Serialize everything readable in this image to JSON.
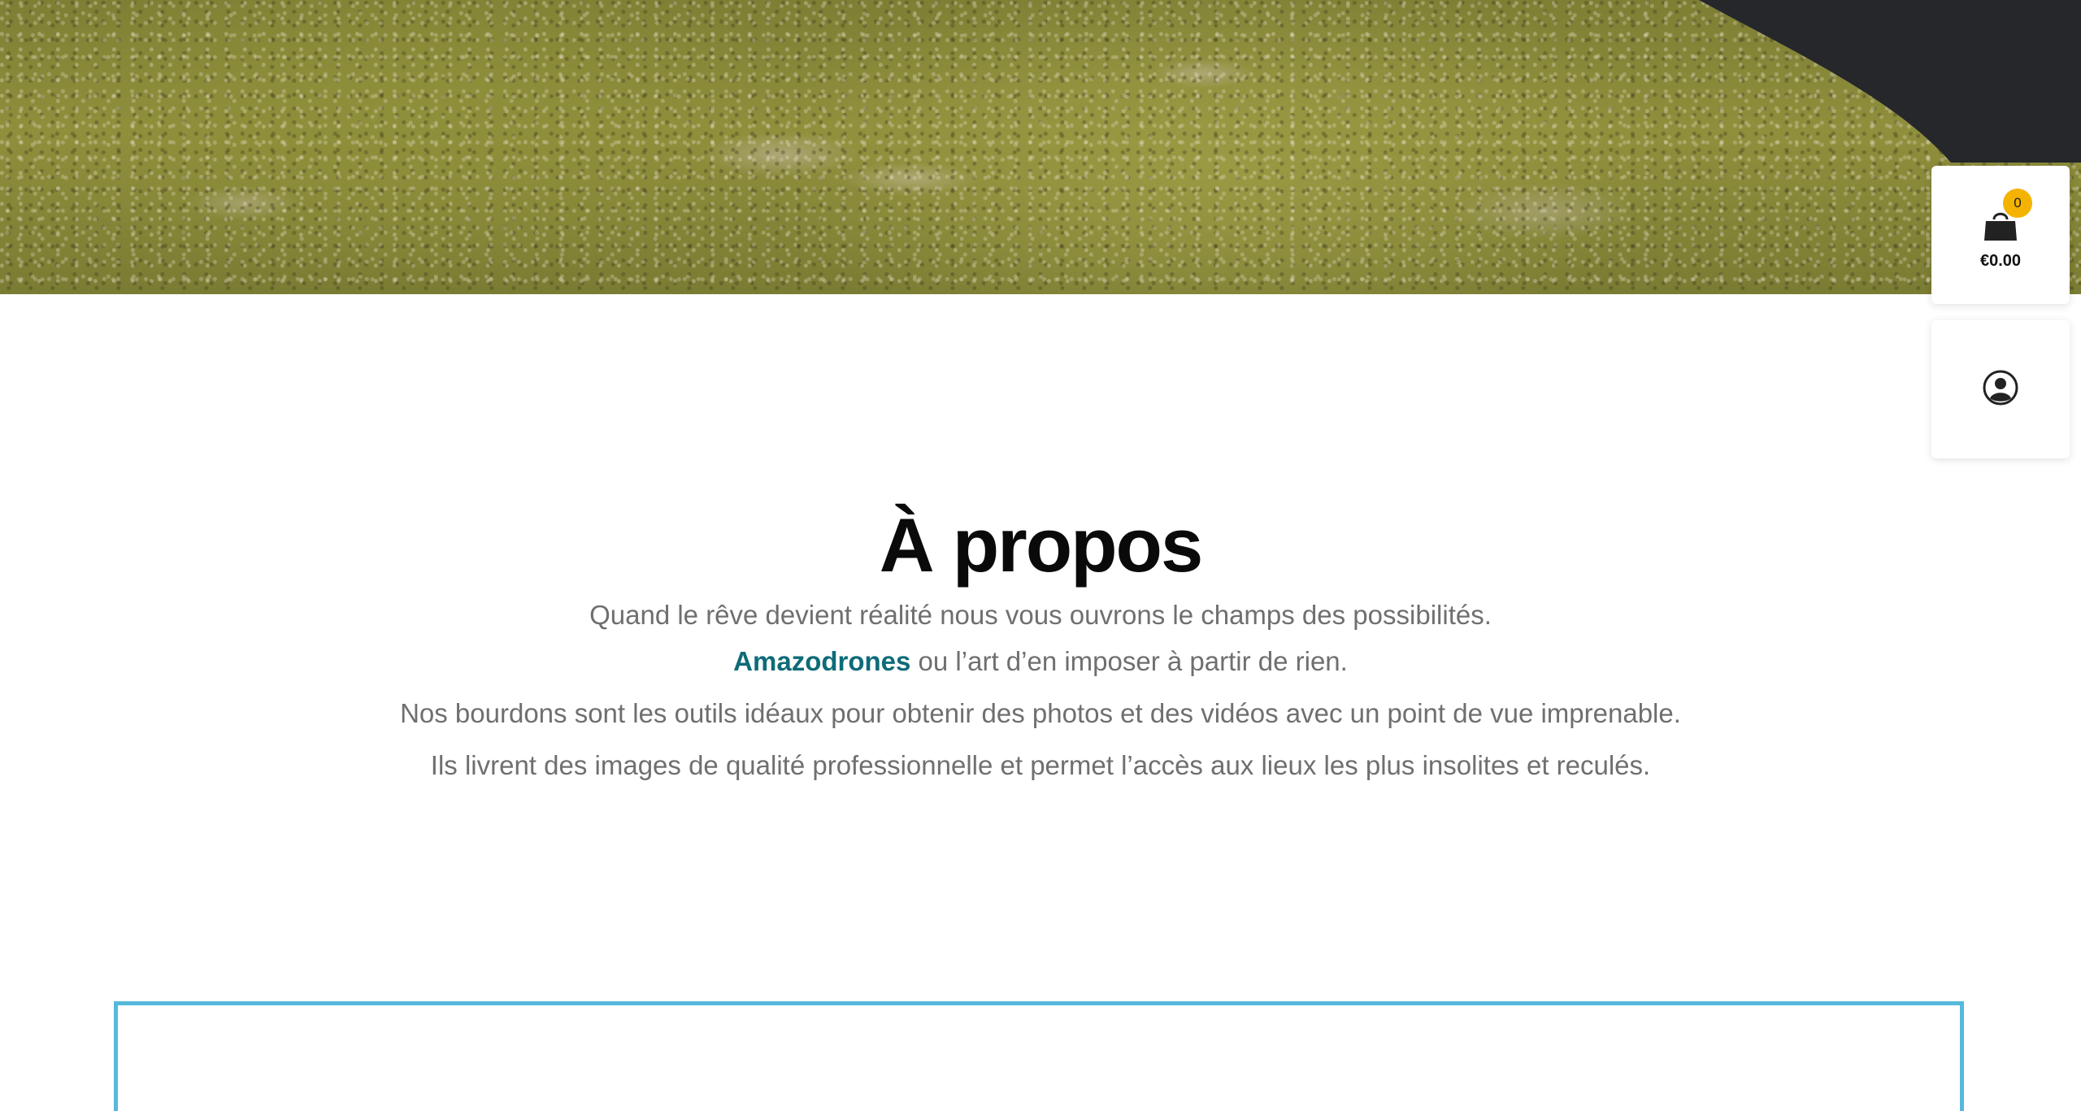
{
  "cart": {
    "count": "0",
    "total": "€0.00",
    "icon": "shopping-bag-icon",
    "badge_color": "#f5b301"
  },
  "account": {
    "icon": "user-circle-icon"
  },
  "about": {
    "title": "À propos",
    "subtitle": "Quand le rêve devient réalité nous vous ouvrons le champs des possibilités.",
    "brand": "Amazodrones",
    "brand_tail": " ou l’art d’en imposer à partir de rien.",
    "body": "Nos bourdons sont les outils idéaux pour obtenir des photos et des vidéos avec un point de vue imprenable. Ils livrent des images de qualité professionnelle et permet l’accès aux lieux les plus insolites et reculés."
  },
  "colors": {
    "brand": "#0e6b78",
    "text": "#6f6f6f",
    "frame_border": "#56b9dc"
  }
}
